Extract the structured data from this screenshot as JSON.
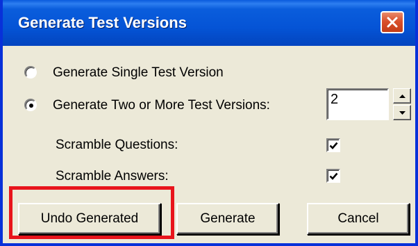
{
  "window": {
    "title": "Generate Test Versions",
    "close_icon": "close-icon"
  },
  "options": {
    "single_label": "Generate Single Test Version",
    "single_selected": false,
    "multiple_label": "Generate Two or More Test Versions:",
    "multiple_selected": true,
    "versions_value": "2"
  },
  "scramble": {
    "questions_label": "Scramble Questions:",
    "questions_checked": true,
    "answers_label": "Scramble Answers:",
    "answers_checked": true
  },
  "buttons": {
    "undo_label": "Undo Generated",
    "generate_label": "Generate",
    "cancel_label": "Cancel"
  },
  "colors": {
    "titlebar": "#0554d6",
    "highlight": "#e8141c",
    "dialog_bg": "#ece9d8"
  }
}
